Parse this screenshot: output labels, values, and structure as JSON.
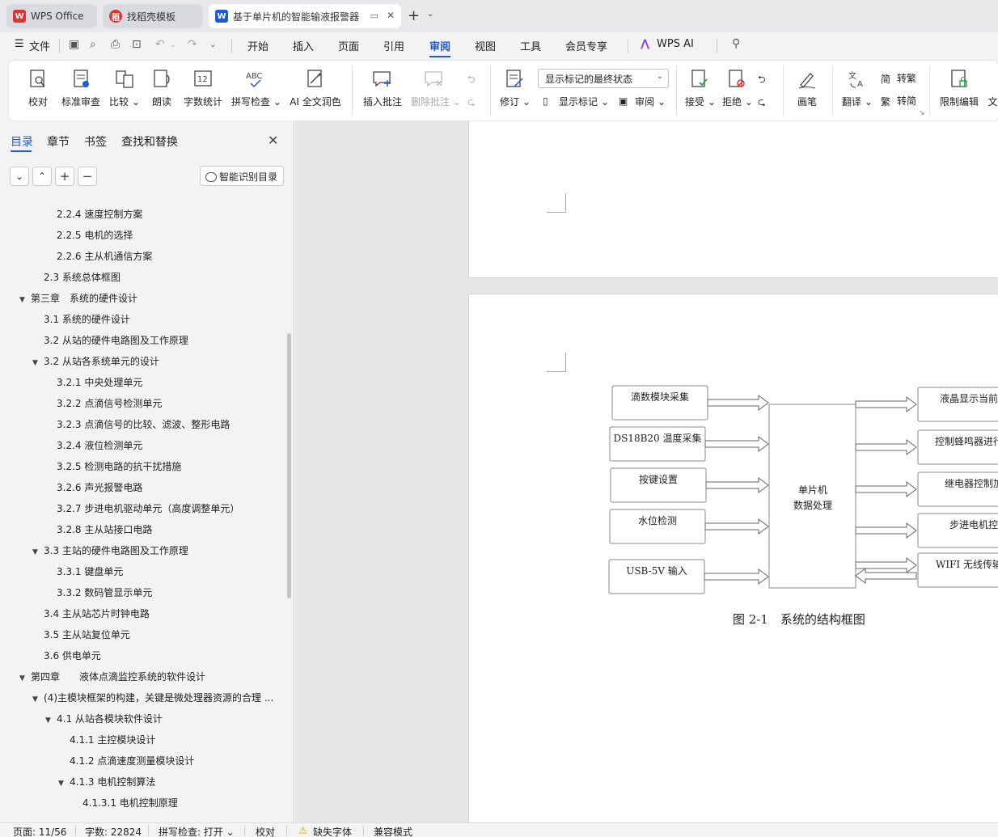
{
  "tabs": [
    {
      "label": "WPS Office",
      "logo": "W"
    },
    {
      "label": "找稻壳模板",
      "logo": "稻"
    },
    {
      "label": "基于单片机的智能输液报警器",
      "logo": "W"
    }
  ],
  "menu": {
    "file": "文件",
    "items": [
      "开始",
      "插入",
      "页面",
      "引用",
      "审阅",
      "视图",
      "工具",
      "会员专享"
    ],
    "active": "审阅",
    "wps_ai": "WPS AI"
  },
  "ribbon": {
    "proofread": "校对",
    "standard_review": "标准审查",
    "compare": "比较",
    "read_aloud": "朗读",
    "word_count": "字数统计",
    "spell_check": "拼写检查",
    "ai_polish": "AI 全文润色",
    "insert_comment": "插入批注",
    "delete_comment": "删除批注",
    "revise": "修订",
    "markup_select": "显示标记的最终状态",
    "show_markup": "显示标记",
    "review": "审阅",
    "accept": "接受",
    "reject": "拒绝",
    "pen": "画笔",
    "translate": "翻译",
    "to_traditional": "转繁",
    "to_simplified": "转简",
    "restrict_edit": "限制编辑",
    "doc_cut": "文"
  },
  "panel": {
    "tabs": [
      "目录",
      "章节",
      "书签",
      "查找和替换"
    ],
    "ai_toc": "智能识别目录"
  },
  "toc": [
    {
      "label": "2.2.4 速度控制方案",
      "level": 3,
      "arrow": ""
    },
    {
      "label": "2.2.5 电机的选择",
      "level": 3,
      "arrow": ""
    },
    {
      "label": "2.2.6 主从机通信方案",
      "level": 3,
      "arrow": ""
    },
    {
      "label": "2.3 系统总体框图",
      "level": 2,
      "arrow": ""
    },
    {
      "label": "第三章　系统的硬件设计",
      "level": 1,
      "arrow": "▼"
    },
    {
      "label": "3.1  系统的硬件设计",
      "level": 2,
      "arrow": ""
    },
    {
      "label": "3.2  从站的硬件电路图及工作原理",
      "level": 2,
      "arrow": ""
    },
    {
      "label": "3.2  从站各系统单元的设计",
      "level": 2,
      "arrow": "▼"
    },
    {
      "label": "3.2.1 中央处理单元",
      "level": 3,
      "arrow": ""
    },
    {
      "label": "3.2.2 点滴信号检测单元",
      "level": 3,
      "arrow": ""
    },
    {
      "label": "3.2.3 点滴信号的比较、滤波、整形电路",
      "level": 3,
      "arrow": ""
    },
    {
      "label": "3.2.4  液位检测单元",
      "level": 3,
      "arrow": ""
    },
    {
      "label": "3.2.5 检测电路的抗干扰措施",
      "level": 3,
      "arrow": ""
    },
    {
      "label": "3.2.6 声光报警电路",
      "level": 3,
      "arrow": ""
    },
    {
      "label": "3.2.7  步进电机驱动单元（高度调整单元）",
      "level": 3,
      "arrow": ""
    },
    {
      "label": "3.2.8  主从站接口电路",
      "level": 3,
      "arrow": ""
    },
    {
      "label": "3.3  主站的硬件电路图及工作原理",
      "level": 2,
      "arrow": "▼"
    },
    {
      "label": "3.3.1 键盘单元",
      "level": 3,
      "arrow": ""
    },
    {
      "label": "3.3.2  数码管显示单元",
      "level": 3,
      "arrow": ""
    },
    {
      "label": "3.4 主从站芯片时钟电路",
      "level": 2,
      "arrow": ""
    },
    {
      "label": "3.5  主从站复位单元",
      "level": 2,
      "arrow": ""
    },
    {
      "label": "3.6 供电单元",
      "level": 2,
      "arrow": ""
    },
    {
      "label": "第四章　　液体点滴监控系统的软件设计",
      "level": 1,
      "arrow": "▼"
    },
    {
      "label": "(4)主模块框架的构建，关键是微处理器资源的合理 ...",
      "level": 2,
      "arrow": "▼"
    },
    {
      "label": "4.1 从站各模块软件设计",
      "level": 3,
      "arrow": "▼"
    },
    {
      "label": "4.1.1 主控模块设计",
      "level": 4,
      "arrow": ""
    },
    {
      "label": "4.1.2 点滴速度测量模块设计",
      "level": 4,
      "arrow": ""
    },
    {
      "label": "4.1.3 电机控制算法",
      "level": 4,
      "arrow": "▼"
    },
    {
      "label": "4.1.3.1  电机控制原理",
      "level": 5,
      "arrow": ""
    }
  ],
  "diagram": {
    "inputs": [
      "滴数模块采集",
      "DS18B20 温度采集",
      "按键设置",
      "水位检测",
      "USB-5V 输入"
    ],
    "center": [
      "单片机",
      "数据处理"
    ],
    "outputs": [
      "液晶显示当前信息",
      "控制蜂鸣器进行报警",
      "继电器控制加热",
      "步进电机控制",
      "WIFI 无线传输控制"
    ],
    "caption": "图 2-1　系统的结构框图"
  },
  "status": {
    "page": "页面: 11/56",
    "words": "字数: 22824",
    "spell": "拼写检查: 打开",
    "proof": "校对",
    "missing_font": "缺失字体",
    "compat": "兼容模式"
  }
}
